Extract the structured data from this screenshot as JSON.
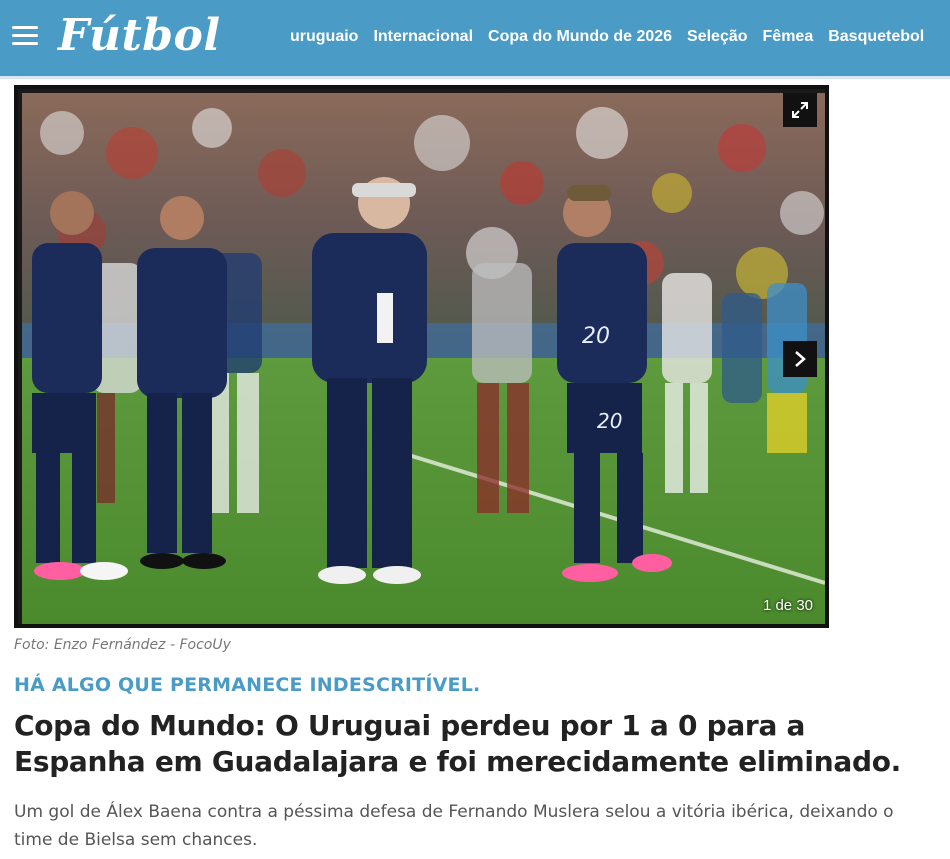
{
  "header": {
    "logo": "Fútbol",
    "menu_icon": "hamburger-menu-icon",
    "nav": [
      "uruguaio",
      "Internacional",
      "Copa do Mundo de 2026",
      "Seleção",
      "Fêmea",
      "Basquetebol"
    ]
  },
  "gallery": {
    "counter": "1 de 30",
    "expand_icon": "expand-icon",
    "next_icon": "chevron-right-icon"
  },
  "article": {
    "photo_credit": "Foto: Enzo Fernández - FocoUy",
    "kicker": "HÁ ALGO QUE PERMANECE INDESCRITÍVEL.",
    "headline": "Copa do Mundo: O Uruguai perdeu por 1 a 0 para a Espanha em Guadalajara e foi merecidamente eliminado.",
    "lede": "Um gol de Álex Baena contra a péssima defesa de Fernando Muslera selou a vitória ibérica, deixando o time de Bielsa sem chances."
  },
  "colors": {
    "brand": "#4a9bc5",
    "text": "#222222",
    "muted": "#777777"
  }
}
